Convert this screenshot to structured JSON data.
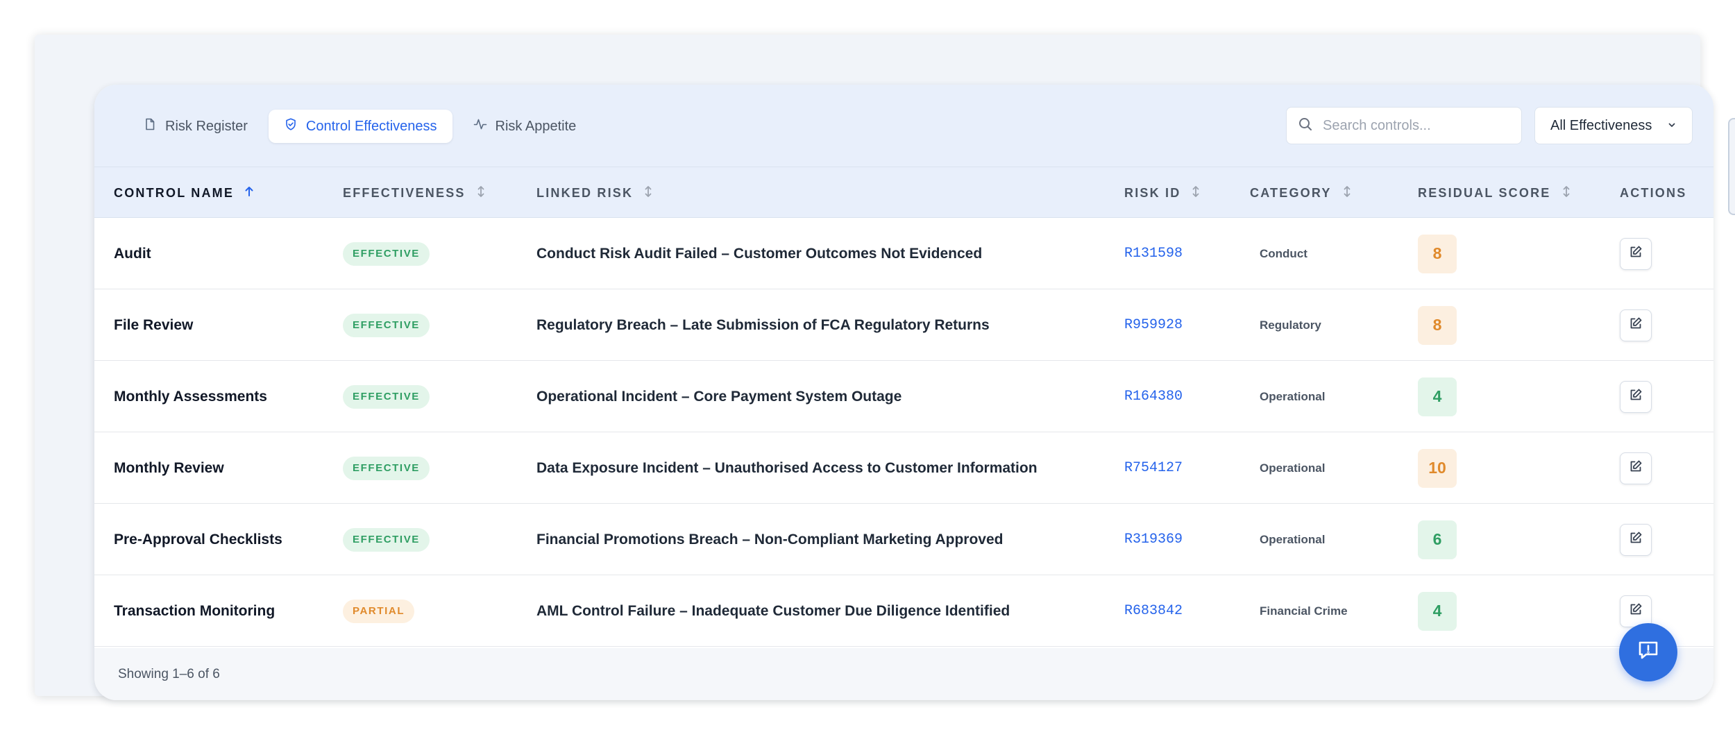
{
  "tabs": [
    {
      "label": "Risk Register",
      "icon": "document-icon",
      "active": false
    },
    {
      "label": "Control Effectiveness",
      "icon": "shield-check-icon",
      "active": true
    },
    {
      "label": "Risk Appetite",
      "icon": "activity-icon",
      "active": false
    }
  ],
  "search": {
    "placeholder": "Search controls...",
    "value": ""
  },
  "filter": {
    "selected": "All Effectiveness"
  },
  "columns": {
    "control_name": "CONTROL NAME",
    "effectiveness": "EFFECTIVENESS",
    "linked_risk": "LINKED RISK",
    "risk_id": "RISK ID",
    "category": "CATEGORY",
    "residual_score": "RESIDUAL SCORE",
    "actions": "ACTIONS"
  },
  "sort": {
    "column": "control_name",
    "direction": "ascending"
  },
  "rows": [
    {
      "name": "Audit",
      "effectiveness": "EFFECTIVE",
      "linked_risk": "Conduct Risk Audit Failed – Customer Outcomes Not Evidenced",
      "risk_id": "R131598",
      "category": "Conduct",
      "score": "8"
    },
    {
      "name": "File Review",
      "effectiveness": "EFFECTIVE",
      "linked_risk": "Regulatory Breach – Late Submission of FCA Regulatory Returns",
      "risk_id": "R959928",
      "category": "Regulatory",
      "score": "8"
    },
    {
      "name": "Monthly Assessments",
      "effectiveness": "EFFECTIVE",
      "linked_risk": "Operational Incident – Core Payment System Outage",
      "risk_id": "R164380",
      "category": "Operational",
      "score": "4"
    },
    {
      "name": "Monthly Review",
      "effectiveness": "EFFECTIVE",
      "linked_risk": "Data Exposure Incident – Unauthorised Access to Customer Information",
      "risk_id": "R754127",
      "category": "Operational",
      "score": "10"
    },
    {
      "name": "Pre-Approval Checklists",
      "effectiveness": "EFFECTIVE",
      "linked_risk": "Financial Promotions Breach – Non-Compliant Marketing Approved",
      "risk_id": "R319369",
      "category": "Operational",
      "score": "6"
    },
    {
      "name": "Transaction Monitoring",
      "effectiveness": "PARTIAL",
      "linked_risk": "AML Control Failure – Inadequate Customer Due Diligence Identified",
      "risk_id": "R683842",
      "category": "Financial Crime",
      "score": "4"
    }
  ],
  "footer": {
    "showing": "Showing 1–6 of 6"
  },
  "colors": {
    "accent": "#2563eb",
    "effective": "#2f9e63",
    "partial": "#e08a2c",
    "score_medium": "#e08a2c",
    "score_low": "#2f9e63",
    "chat_button": "#2f6fe0"
  },
  "chat_button": {
    "icon": "chat-alert-icon"
  }
}
